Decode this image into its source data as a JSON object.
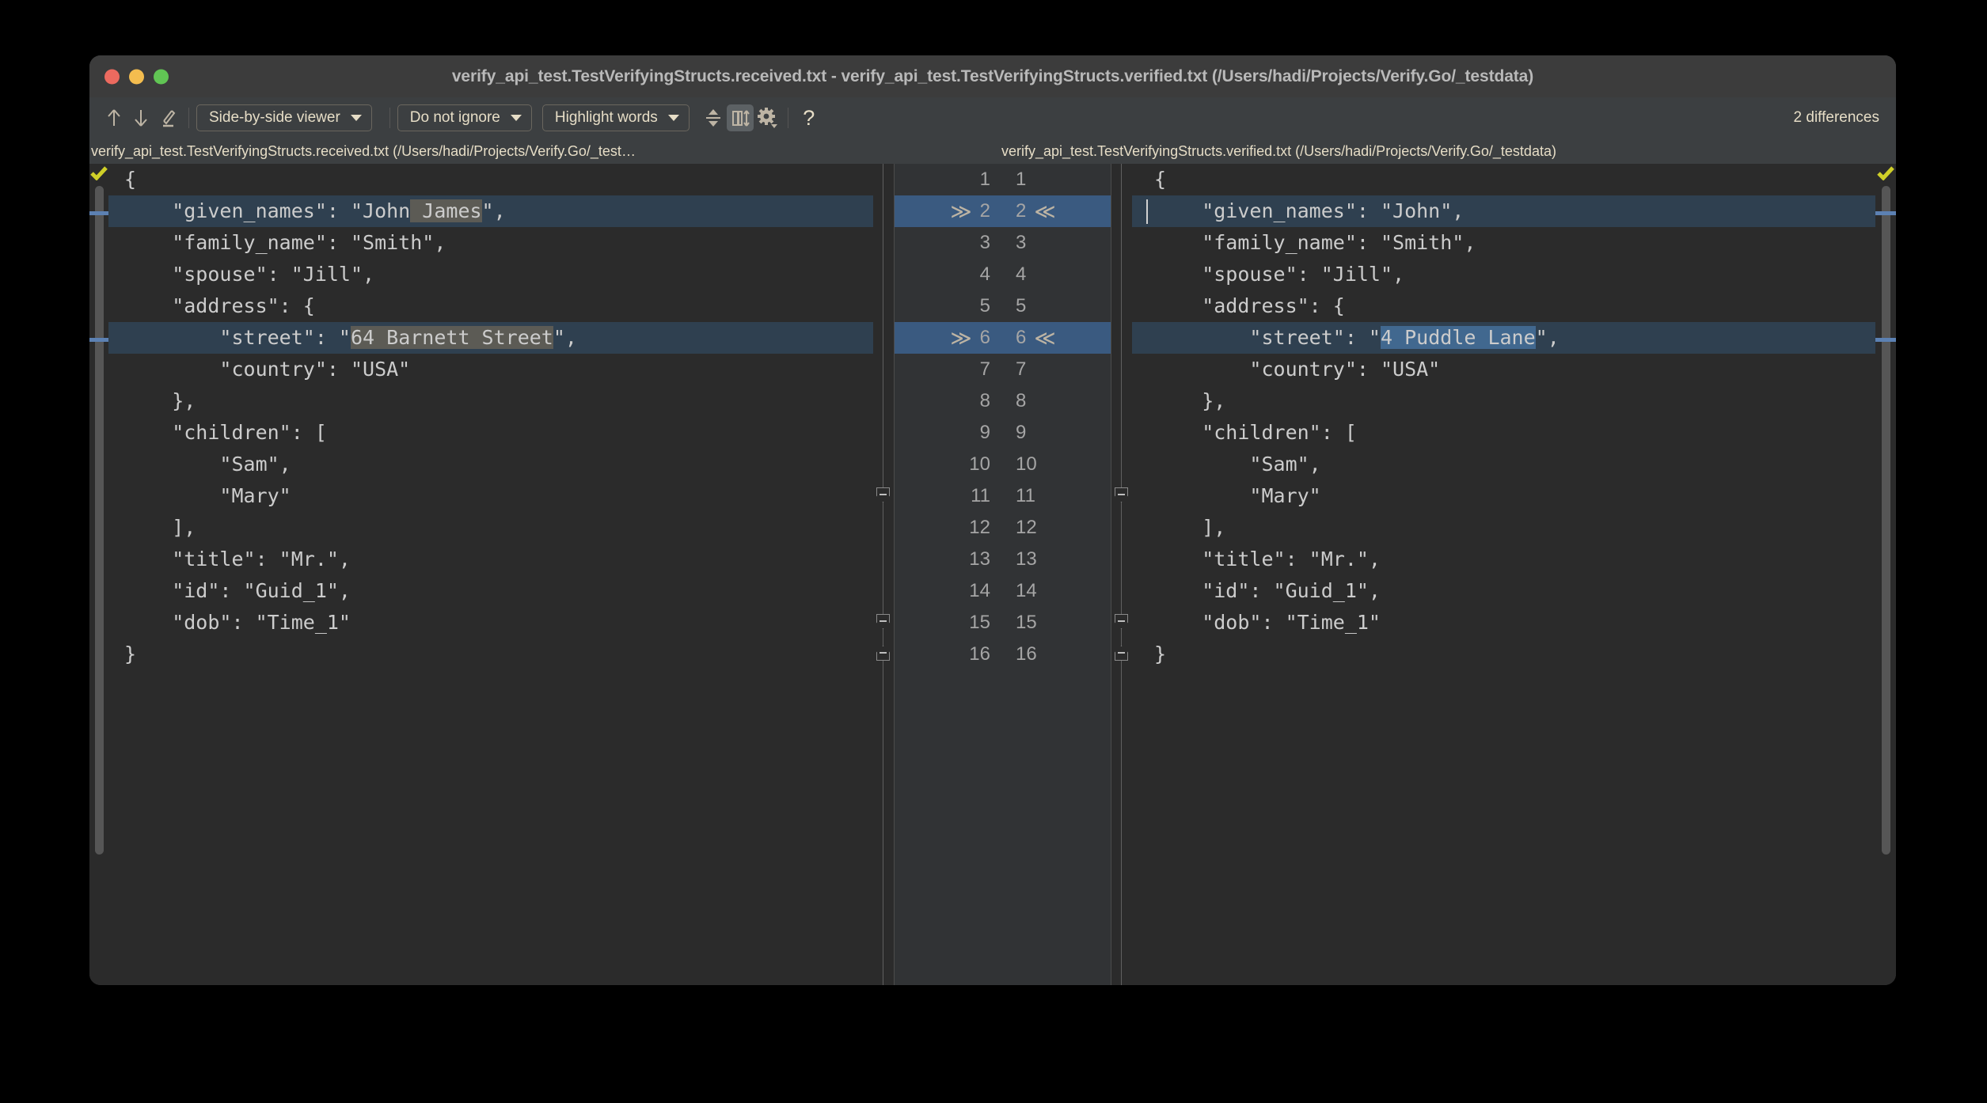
{
  "window": {
    "title": "verify_api_test.TestVerifyingStructs.received.txt - verify_api_test.TestVerifyingStructs.verified.txt (/Users/hadi/Projects/Verify.Go/_testdata)"
  },
  "toolbar": {
    "prev_diff_label": "↑",
    "next_diff_label": "↓",
    "edit_label": "✎",
    "viewer_select": "Side-by-side viewer",
    "ignore_select": "Do not ignore",
    "highlight_select": "Highlight words",
    "collapse_label": "collapse-unchanged-icon",
    "sync_label": "sync-scroll-icon",
    "settings_label": "gear-icon",
    "help_label": "?",
    "differences": "2 differences"
  },
  "paths": {
    "left": "verify_api_test.TestVerifyingStructs.received.txt (/Users/hadi/Projects/Verify.Go/_test…",
    "right": "verify_api_test.TestVerifyingStructs.verified.txt (/Users/hadi/Projects/Verify.Go/_testdata)"
  },
  "colors": {
    "diff_line_bg": "#2f4050",
    "diff_gutter_bg": "#3a5a80",
    "word_left_bg": "#5c5b55",
    "word_right_bg": "#41688f",
    "accent_text": "#e6ddc6",
    "check_ok": "#cfcf28"
  },
  "gutter": {
    "lines": [
      {
        "left": "1",
        "right": "1",
        "diff": false
      },
      {
        "left": "2",
        "right": "2",
        "diff": true
      },
      {
        "left": "3",
        "right": "3",
        "diff": false
      },
      {
        "left": "4",
        "right": "4",
        "diff": false
      },
      {
        "left": "5",
        "right": "5",
        "diff": false
      },
      {
        "left": "6",
        "right": "6",
        "diff": true
      },
      {
        "left": "7",
        "right": "7",
        "diff": false
      },
      {
        "left": "8",
        "right": "8",
        "diff": false
      },
      {
        "left": "9",
        "right": "9",
        "diff": false
      },
      {
        "left": "10",
        "right": "10",
        "diff": false
      },
      {
        "left": "11",
        "right": "11",
        "diff": false
      },
      {
        "left": "12",
        "right": "12",
        "diff": false
      },
      {
        "left": "13",
        "right": "13",
        "diff": false
      },
      {
        "left": "14",
        "right": "14",
        "diff": false
      },
      {
        "left": "15",
        "right": "15",
        "diff": false
      },
      {
        "left": "16",
        "right": "16",
        "diff": false
      }
    ],
    "marker_prev": "≫",
    "marker_next": "≪"
  },
  "left_pane": {
    "lines": [
      {
        "pre": "{",
        "hl": "",
        "post": "",
        "diff": false
      },
      {
        "pre": "    \"given_names\": \"John",
        "hl": " James",
        "post": "\",",
        "diff": true
      },
      {
        "pre": "    \"family_name\": \"Smith\",",
        "hl": "",
        "post": "",
        "diff": false
      },
      {
        "pre": "    \"spouse\": \"Jill\",",
        "hl": "",
        "post": "",
        "diff": false
      },
      {
        "pre": "    \"address\": {",
        "hl": "",
        "post": "",
        "diff": false
      },
      {
        "pre": "        \"street\": \"",
        "hl": "64 Barnett Street",
        "post": "\",",
        "diff": true
      },
      {
        "pre": "        \"country\": \"USA\"",
        "hl": "",
        "post": "",
        "diff": false
      },
      {
        "pre": "    },",
        "hl": "",
        "post": "",
        "diff": false
      },
      {
        "pre": "    \"children\": [",
        "hl": "",
        "post": "",
        "diff": false
      },
      {
        "pre": "        \"Sam\",",
        "hl": "",
        "post": "",
        "diff": false
      },
      {
        "pre": "        \"Mary\"",
        "hl": "",
        "post": "",
        "diff": false
      },
      {
        "pre": "    ],",
        "hl": "",
        "post": "",
        "diff": false
      },
      {
        "pre": "    \"title\": \"Mr.\",",
        "hl": "",
        "post": "",
        "diff": false
      },
      {
        "pre": "    \"id\": \"Guid_1\",",
        "hl": "",
        "post": "",
        "diff": false
      },
      {
        "pre": "    \"dob\": \"Time_1\"",
        "hl": "",
        "post": "",
        "diff": false
      },
      {
        "pre": "}",
        "hl": "",
        "post": "",
        "diff": false
      }
    ]
  },
  "right_pane": {
    "lines": [
      {
        "pre": "{",
        "hl": "",
        "post": "",
        "diff": false,
        "caret": false
      },
      {
        "pre": "    \"given_names\": \"John\",",
        "hl": "",
        "post": "",
        "diff": true,
        "caret": true
      },
      {
        "pre": "    \"family_name\": \"Smith\",",
        "hl": "",
        "post": "",
        "diff": false,
        "caret": false
      },
      {
        "pre": "    \"spouse\": \"Jill\",",
        "hl": "",
        "post": "",
        "diff": false,
        "caret": false
      },
      {
        "pre": "    \"address\": {",
        "hl": "",
        "post": "",
        "diff": false,
        "caret": false
      },
      {
        "pre": "        \"street\": \"",
        "hl": "4 Puddle Lane",
        "post": "\",",
        "diff": true,
        "caret": false
      },
      {
        "pre": "        \"country\": \"USA\"",
        "hl": "",
        "post": "",
        "diff": false,
        "caret": false
      },
      {
        "pre": "    },",
        "hl": "",
        "post": "",
        "diff": false,
        "caret": false
      },
      {
        "pre": "    \"children\": [",
        "hl": "",
        "post": "",
        "diff": false,
        "caret": false
      },
      {
        "pre": "        \"Sam\",",
        "hl": "",
        "post": "",
        "diff": false,
        "caret": false
      },
      {
        "pre": "        \"Mary\"",
        "hl": "",
        "post": "",
        "diff": false,
        "caret": false
      },
      {
        "pre": "    ],",
        "hl": "",
        "post": "",
        "diff": false,
        "caret": false
      },
      {
        "pre": "    \"title\": \"Mr.\",",
        "hl": "",
        "post": "",
        "diff": false,
        "caret": false
      },
      {
        "pre": "    \"id\": \"Guid_1\",",
        "hl": "",
        "post": "",
        "diff": false,
        "caret": false
      },
      {
        "pre": "    \"dob\": \"Time_1\"",
        "hl": "",
        "post": "",
        "diff": false,
        "caret": false
      },
      {
        "pre": "",
        "hl": "",
        "post": "",
        "diff": false,
        "caret": false
      }
    ],
    "last_brace": "}"
  },
  "folds": [
    {
      "line": 11,
      "type": "down"
    },
    {
      "line": 15,
      "type": "down"
    },
    {
      "line": 16,
      "type": "up"
    }
  ]
}
